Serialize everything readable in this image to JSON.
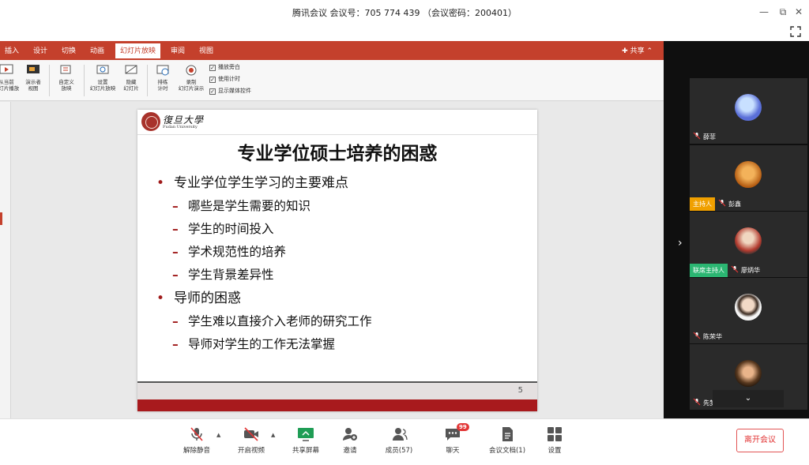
{
  "window": {
    "title": "腾讯会议 会议号：705 774 439 （会议密码：200401）",
    "minimize_glyph": "—",
    "restore_glyph": "⧉",
    "close_glyph": "✕"
  },
  "shared_screen": {
    "ribbon_tabs": [
      "插入",
      "设计",
      "切换",
      "动画",
      "幻灯片放映",
      "审阅",
      "视图"
    ],
    "active_tab": "幻灯片放映",
    "share_label": "共享",
    "ribbon_buttons": [
      {
        "label": "从当前幻灯片播放",
        "line1": "从当前",
        "line2": "幻灯片播放",
        "icon": "play-current-icon"
      },
      {
        "label": "演示者视图",
        "line1": "演示者",
        "line2": "视图",
        "icon": "presenter-view-icon"
      },
      {
        "label": "自定义放映",
        "line1": "自定义",
        "line2": "放映",
        "icon": "custom-show-icon"
      },
      {
        "label": "设置幻灯片放映",
        "line1": "设置",
        "line2": "幻灯片放映",
        "icon": "setup-show-icon"
      },
      {
        "label": "隐藏幻灯片",
        "line1": "隐藏",
        "line2": "幻灯片",
        "icon": "hide-slide-icon"
      },
      {
        "label": "排练计时",
        "line1": "排练",
        "line2": "计时",
        "icon": "rehearse-timing-icon"
      },
      {
        "label": "录制幻灯片演示",
        "line1": "录制",
        "line2": "幻灯片演示",
        "icon": "record-show-icon"
      }
    ],
    "checkboxes": [
      {
        "label": "播放旁白",
        "checked": true
      },
      {
        "label": "使用计时",
        "checked": true
      },
      {
        "label": "显示媒体控件",
        "checked": true
      }
    ],
    "slide": {
      "university_cn": "復旦大學",
      "university_en": "Fudan University",
      "title": "专业学位硕士培养的困惑",
      "bullets": [
        {
          "text": "专业学位学生学习的主要难点",
          "sub": [
            "哪些是学生需要的知识",
            "学生的时间投入",
            "学术规范性的培养",
            "学生背景差异性"
          ]
        },
        {
          "text": "导师的困惑",
          "sub": [
            "学生难以直接介入老师的研究工作",
            "导师对学生的工作无法掌握"
          ]
        }
      ],
      "bullet_glyph": "•",
      "dash_glyph": "–",
      "page_number": "5"
    }
  },
  "participants": [
    {
      "name": "薛菲",
      "tag": "",
      "avatar_color": "#5a6fd8"
    },
    {
      "name": "彭鑫",
      "tag": "主持人",
      "avatar_color": "#e08a1e"
    },
    {
      "name": "廖炳华",
      "tag": "联席主持人",
      "avatar_color": "#b23a2e"
    },
    {
      "name": "陈荣华",
      "tag": "",
      "avatar_color": "#e8e8e8"
    },
    {
      "name": "先梦涵",
      "tag": "",
      "avatar_color": "#5a3a20"
    }
  ],
  "panel_nav": {
    "expand_glyph": "›",
    "scroll_down_glyph": "⌄"
  },
  "toolbar": {
    "buttons": [
      {
        "label": "解除静音",
        "icon": "mic-muted-icon"
      },
      {
        "label": "开启视频",
        "icon": "video-off-icon"
      },
      {
        "label": "共享屏幕",
        "icon": "share-screen-icon"
      },
      {
        "label": "邀请",
        "icon": "invite-icon"
      },
      {
        "label": "成员(57)",
        "icon": "members-icon"
      },
      {
        "label": "聊天",
        "icon": "chat-icon"
      },
      {
        "label": "会议文档(1)",
        "icon": "document-icon"
      },
      {
        "label": "设置",
        "icon": "settings-icon"
      }
    ],
    "chat_badge": "99",
    "leave_label": "离开会议",
    "caret_glyph": "▲"
  },
  "colors": {
    "ribbon_red": "#c4402c",
    "slide_red": "#a81a1d",
    "host_tag": "#f0a000",
    "cohost_tag": "#2bb672",
    "leave_red": "#e23636",
    "share_green": "#1f9d55"
  }
}
